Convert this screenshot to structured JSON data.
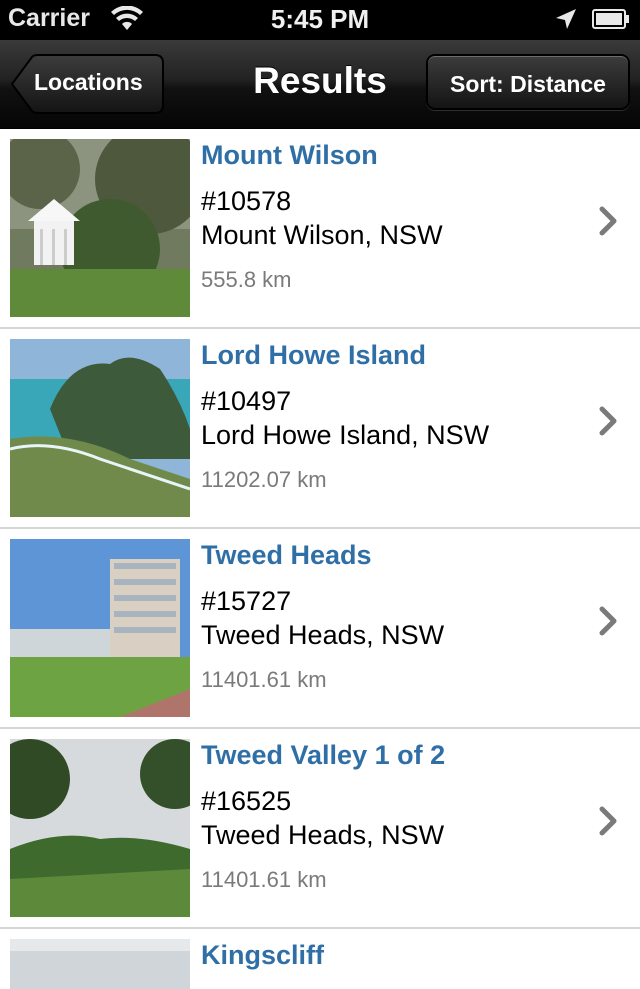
{
  "status_bar": {
    "carrier": "Carrier",
    "time": "5:45 PM"
  },
  "nav": {
    "back_label": "Locations",
    "title": "Results",
    "sort_label": "Sort: Distance"
  },
  "results": [
    {
      "title": "Mount Wilson",
      "code": "#10578",
      "place": "Mount Wilson, NSW",
      "distance": "555.8 km"
    },
    {
      "title": "Lord Howe Island",
      "code": "#10497",
      "place": "Lord Howe Island, NSW",
      "distance": "11202.07 km"
    },
    {
      "title": "Tweed Heads",
      "code": "#15727",
      "place": "Tweed Heads, NSW",
      "distance": "11401.61 km"
    },
    {
      "title": "Tweed Valley 1 of 2",
      "code": "#16525",
      "place": "Tweed Heads, NSW",
      "distance": "11401.61 km"
    },
    {
      "title": "Kingscliff"
    }
  ],
  "colors": {
    "link_title": "#2f6fa6",
    "distance_text": "#7a7a7a",
    "navbar": "#1a1a1a"
  },
  "icons": [
    "wifi-icon",
    "location-arrow-icon",
    "battery-icon",
    "chevron-right-icon"
  ]
}
